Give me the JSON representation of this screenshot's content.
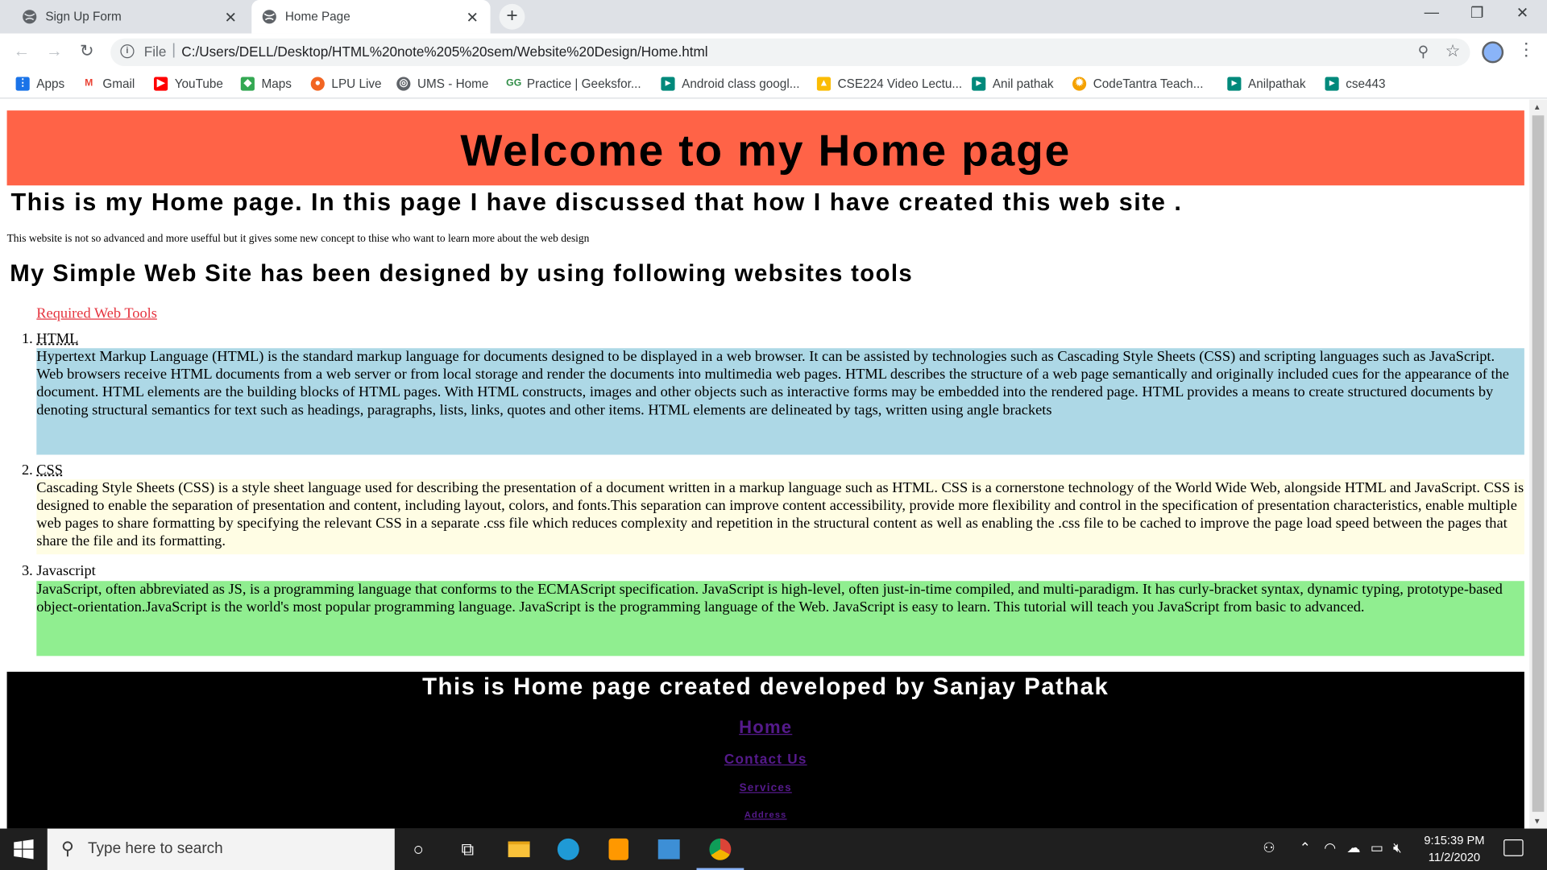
{
  "browser": {
    "tabs": [
      {
        "title": "Sign Up Form",
        "active": false
      },
      {
        "title": "Home Page",
        "active": true
      }
    ],
    "address": {
      "scheme": "File",
      "url": "C:/Users/DELL/Desktop/HTML%20note%205%20sem/Website%20Design/Home.html"
    },
    "bookmarks": [
      {
        "label": "Apps",
        "icon": "apps-grid-icon",
        "color": "#1a73e8"
      },
      {
        "label": "Gmail",
        "icon": "gmail-icon",
        "color": "#ea4335"
      },
      {
        "label": "YouTube",
        "icon": "youtube-icon",
        "color": "#ff0000"
      },
      {
        "label": "Maps",
        "icon": "maps-icon",
        "color": "#34a853"
      },
      {
        "label": "LPU Live",
        "icon": "lpu-live-icon",
        "color": "#f26522"
      },
      {
        "label": "UMS - Home",
        "icon": "globe-icon",
        "color": "#5f6368"
      },
      {
        "label": "Practice | Geeksfor...",
        "icon": "geeksforgeeks-icon",
        "color": "#2f8d46"
      },
      {
        "label": "Android class googl...",
        "icon": "meet-icon",
        "color": "#00897b"
      },
      {
        "label": "CSE224 Video Lectu...",
        "icon": "drive-icon",
        "color": "#fbbc04"
      },
      {
        "label": "Anil pathak",
        "icon": "meet-icon",
        "color": "#00897b"
      },
      {
        "label": "CodeTantra Teach...",
        "icon": "codetantra-icon",
        "color": "#f4a100"
      },
      {
        "label": "Anilpathak",
        "icon": "meet-icon",
        "color": "#00897b"
      },
      {
        "label": "cse443",
        "icon": "meet-icon",
        "color": "#00897b"
      }
    ]
  },
  "page": {
    "banner": "Welcome to my Home page",
    "subheading": "This is my Home page. In this page I have discussed that how I have created this web site .",
    "intro": "This website is not so advanced and more usefful but it gives some new concept to thise who want to learn more about the web design",
    "tools_heading": "My Simple Web Site has been designed by using following websites tools",
    "required_link": "Required Web Tools",
    "tools": [
      {
        "num": "1.",
        "title": "HTML",
        "text": "Hypertext Markup Language (HTML) is the standard markup language for documents designed to be displayed in a web browser. It can be assisted by technologies such as Cascading Style Sheets (CSS) and scripting languages such as JavaScript. Web browsers receive HTML documents from a web server or from local storage and render the documents into multimedia web pages. HTML describes the structure of a web page semantically and originally included cues for the appearance of the document. HTML elements are the building blocks of HTML pages. With HTML constructs, images and other objects such as interactive forms may be embedded into the rendered page. HTML provides a means to create structured documents by denoting structural semantics for text such as headings, paragraphs, lists, links, quotes and other items. HTML elements are delineated by tags, written using angle brackets"
      },
      {
        "num": "2.",
        "title": "CSS",
        "text": "Cascading Style Sheets (CSS) is a style sheet language used for describing the presentation of a document written in a markup language such as HTML. CSS is a cornerstone technology of the World Wide Web, alongside HTML and JavaScript. CSS is designed to enable the separation of presentation and content, including layout, colors, and fonts.This separation can improve content accessibility, provide more flexibility and control in the specification of presentation characteristics, enable multiple web pages to share formatting by specifying the relevant CSS in a separate .css file which reduces complexity and repetition in the structural content as well as enabling the .css file to be cached to improve the page load speed between the pages that share the file and its formatting."
      },
      {
        "num": "3.",
        "title": "Javascript",
        "text": "JavaScript, often abbreviated as JS, is a programming language that conforms to the ECMAScript specification. JavaScript is high-level, often just-in-time compiled, and multi-paradigm. It has curly-bracket syntax, dynamic typing, prototype-based object-orientation.JavaScript is the world's most popular programming language. JavaScript is the programming language of the Web. JavaScript is easy to learn. This tutorial will teach you JavaScript from basic to advanced."
      }
    ],
    "footer": {
      "title": "This is Home page created developed by Sanjay Pathak",
      "links": [
        "Home",
        "Contact Us",
        "Services",
        "Address"
      ]
    }
  },
  "taskbar": {
    "search_placeholder": "Type here to search",
    "time": "9:15:39 PM",
    "date": "11/2/2020"
  },
  "colors": {
    "banner": "#ff6347",
    "html_box": "#add8e6",
    "css_box": "#fffde4",
    "js_box": "#90ee90",
    "link_red": "#e5343f",
    "visited_link": "#551a8b"
  }
}
